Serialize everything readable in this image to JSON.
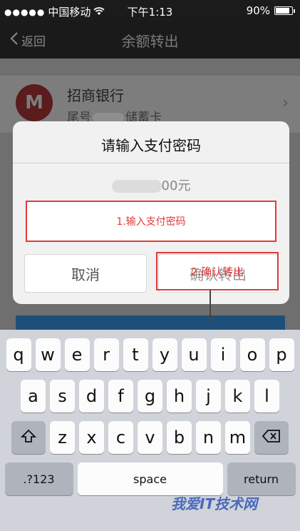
{
  "status": {
    "carrier": "中国移动",
    "time": "下午1:13",
    "battery": "90%",
    "battery_level": 0.9
  },
  "nav": {
    "back_label": "返回",
    "title": "余额转出"
  },
  "bank": {
    "name": "招商银行",
    "prefix": "尾号",
    "card_type": "储蓄卡"
  },
  "dialog": {
    "title": "请输入支付密码",
    "amount_suffix": "00元",
    "password_annotation": "1.输入支付密码",
    "cancel_label": "取消",
    "confirm_label": "确认转出",
    "confirm_annotation": "2.确认转出"
  },
  "keyboard": {
    "row1": [
      "q",
      "w",
      "e",
      "r",
      "t",
      "y",
      "u",
      "i",
      "o",
      "p"
    ],
    "row2": [
      "a",
      "s",
      "d",
      "f",
      "g",
      "h",
      "j",
      "k",
      "l"
    ],
    "row3": [
      "z",
      "x",
      "c",
      "v",
      "b",
      "n",
      "m"
    ],
    "numbers_key": ".?123",
    "space_key": "space",
    "return_key": "return"
  },
  "watermark": "我爱IT技术网"
}
